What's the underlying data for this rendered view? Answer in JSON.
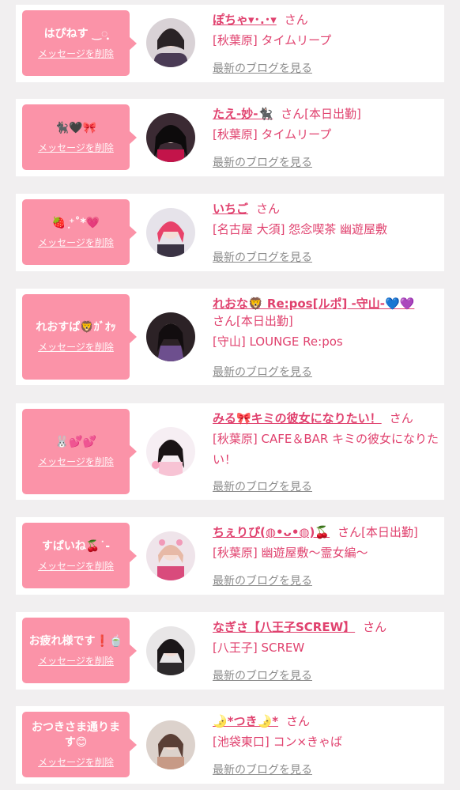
{
  "colors": {
    "accent": "#e0416e",
    "bubble": "#fb93a8",
    "background": "#f1eff0"
  },
  "cards": [
    {
      "bubble_text": "はぴねす ‿◌̥̥͙",
      "delete_label": "メッセージを削除",
      "name": "ぽちゃ▾･.･▾",
      "honorific": "さん",
      "status": "",
      "shop": "[秋葉原] タイムリープ",
      "blog_label": "最新のブログを見る"
    },
    {
      "bubble_text": "🐈‍⬛🖤🎀",
      "delete_label": "メッセージを削除",
      "name": "たえ-妙-🐈‍⬛",
      "honorific": "さん",
      "status": "[本日出勤]",
      "shop": "[秋葉原] タイムリープ",
      "blog_label": "最新のブログを見る"
    },
    {
      "bubble_text": "🍓 ͙⁺˚*💗",
      "delete_label": "メッセージを削除",
      "name": "いちご",
      "honorific": "さん",
      "status": "",
      "shop": "[名古屋 大須] 怨念喫茶 幽遊屋敷",
      "blog_label": "最新のブログを見る"
    },
    {
      "bubble_text": "れおすぱ🦁ｶﾞｵｯ",
      "delete_label": "メッセージを削除",
      "name": "れおな🦁 Re:pos[ルポ] -守山-💙💜",
      "honorific": "さん",
      "status": "[本日出勤]",
      "shop": "[守山] LOUNGE Re:pos",
      "blog_label": "最新のブログを見る"
    },
    {
      "bubble_text": "🐰💕💕",
      "delete_label": "メッセージを削除",
      "name": "みる🎀キミの彼女になりたい！",
      "honorific": "さん",
      "status": "",
      "shop": "[秋葉原] CAFE＆BAR キミの彼女になりたい！",
      "blog_label": "最新のブログを見る"
    },
    {
      "bubble_text": "すぱいね🍒˙-",
      "delete_label": "メッセージを削除",
      "name": "ちぇりぴ(◍•ᴗ•◍)🍒",
      "honorific": "さん",
      "status": "[本日出勤]",
      "shop": "[秋葉原] 幽遊屋敷〜霊女編〜",
      "blog_label": "最新のブログを見る"
    },
    {
      "bubble_text": "お疲れ様です❗️🍵",
      "delete_label": "メッセージを削除",
      "name": "なぎさ【八王子SCREW】",
      "honorific": "さん",
      "status": "",
      "shop": "[八王子] SCREW",
      "blog_label": "最新のブログを見る"
    },
    {
      "bubble_text": "おつきさま通ります😊",
      "delete_label": "メッセージを削除",
      "name": "🌛*つき🌛*",
      "honorific": "さん",
      "status": "",
      "shop": "[池袋東口] コン×きゃば",
      "blog_label": "最新のブログを見る"
    }
  ]
}
